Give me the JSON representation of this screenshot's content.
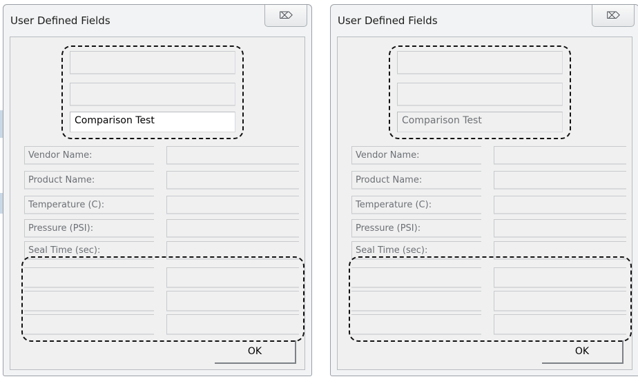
{
  "dialogs": [
    {
      "state": "before",
      "title": "User Defined Fields",
      "close_glyph": "⌦",
      "comparison_value": "Comparison Test",
      "labels": [
        "Vendor Name:",
        "Product Name:",
        "Temperature (C):",
        "Pressure (PSI):",
        "Seal Time (sec):"
      ],
      "ok_label": "OK"
    },
    {
      "state": "after",
      "title": "User Defined Fields",
      "close_glyph": "⌦",
      "comparison_value": "Comparison Test",
      "labels": [
        "Vendor Name:",
        "Product Name:",
        "Temperature (C):",
        "Pressure (PSI):",
        "Seal Time (sec):"
      ],
      "ok_label": "OK"
    }
  ],
  "icons": {
    "close": "close-icon"
  },
  "colors": {
    "highlight": "#111111",
    "window_bg": "#f2f3f4",
    "disabled_text": "#6c7075"
  }
}
